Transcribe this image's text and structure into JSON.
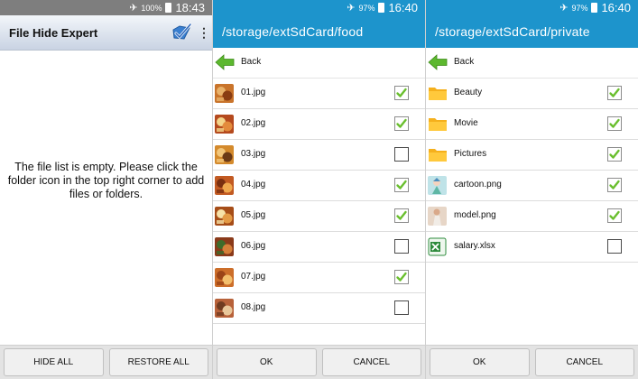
{
  "panel1": {
    "status": {
      "battery": "100%",
      "time": "18:43"
    },
    "title": "File Hide Expert",
    "icons": {
      "add_folder": "add-folder-check-icon",
      "more": "more-vert-icon"
    },
    "empty_message": "The file list is empty. Please click the folder icon in the top right corner to add files or folders.",
    "buttons": {
      "hide_all": "HIDE ALL",
      "restore_all": "RESTORE ALL"
    }
  },
  "panel2": {
    "status": {
      "battery": "97%",
      "time": "16:40"
    },
    "path": "/storage/extSdCard/food",
    "back_label": "Back",
    "items": [
      {
        "name": "01.jpg",
        "checked": true,
        "icon": "food-thumbnail"
      },
      {
        "name": "02.jpg",
        "checked": true,
        "icon": "food-thumbnail"
      },
      {
        "name": "03.jpg",
        "checked": false,
        "icon": "food-thumbnail"
      },
      {
        "name": "04.jpg",
        "checked": true,
        "icon": "food-thumbnail"
      },
      {
        "name": "05.jpg",
        "checked": true,
        "icon": "food-thumbnail"
      },
      {
        "name": "06.jpg",
        "checked": false,
        "icon": "food-thumbnail"
      },
      {
        "name": "07.jpg",
        "checked": true,
        "icon": "food-thumbnail"
      },
      {
        "name": "08.jpg",
        "checked": false,
        "icon": "food-thumbnail"
      }
    ],
    "buttons": {
      "ok": "OK",
      "cancel": "CANCEL"
    }
  },
  "panel3": {
    "status": {
      "battery": "97%",
      "time": "16:40"
    },
    "path": "/storage/extSdCard/private",
    "back_label": "Back",
    "items": [
      {
        "name": "Beauty",
        "checked": true,
        "icon": "folder-icon"
      },
      {
        "name": "Movie",
        "checked": true,
        "icon": "folder-icon"
      },
      {
        "name": "Pictures",
        "checked": true,
        "icon": "folder-icon"
      },
      {
        "name": "cartoon.png",
        "checked": true,
        "icon": "image-thumbnail"
      },
      {
        "name": "model.png",
        "checked": true,
        "icon": "image-thumbnail"
      },
      {
        "name": "salary.xlsx",
        "checked": false,
        "icon": "excel-file-icon"
      }
    ],
    "buttons": {
      "ok": "OK",
      "cancel": "CANCEL"
    }
  },
  "colors": {
    "accent_blue": "#1d94cc",
    "check_green": "#6abf2e",
    "status_gray": "#7e7e7e"
  }
}
